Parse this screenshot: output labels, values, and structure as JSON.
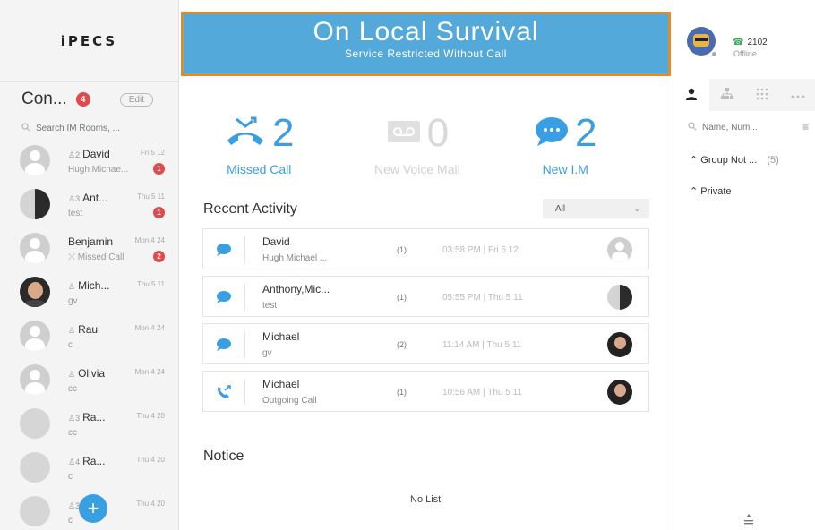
{
  "app": {
    "logo": "iPECS"
  },
  "banner": {
    "title": "On Local Survival",
    "subtitle": "Service Restricted Without Call"
  },
  "conversations": {
    "title": "Con...",
    "badge": "4",
    "edit_label": "Edit",
    "search_placeholder": "Search IM Rooms, ...",
    "items": [
      {
        "count": "2",
        "name": "David",
        "time": "Fri 5 12",
        "sub": "Hugh Michae...",
        "badge": "1",
        "avatar": "generic"
      },
      {
        "count": "3",
        "name": "Ant...",
        "time": "Thu 5 11",
        "sub": "test",
        "badge": "1",
        "avatar": "split"
      },
      {
        "count": "",
        "name": "Benjamin",
        "time": "Mon 4 24",
        "sub": "Missed Call",
        "badge": "2",
        "avatar": "generic"
      },
      {
        "count": "",
        "name": "Mich...",
        "time": "Thu 5 11",
        "sub": "gv",
        "badge": "",
        "avatar": "photo"
      },
      {
        "count": "",
        "name": "Raul",
        "time": "Mon 4 24",
        "sub": "c",
        "badge": "",
        "avatar": "generic"
      },
      {
        "count": "",
        "name": "Olivia",
        "time": "Mon 4 24",
        "sub": "cc",
        "badge": "",
        "avatar": "generic"
      },
      {
        "count": "3",
        "name": "Ra...",
        "time": "Thu 4 20",
        "sub": "cc",
        "badge": "",
        "avatar": "group"
      },
      {
        "count": "4",
        "name": "Ra...",
        "time": "Thu 4 20",
        "sub": "c",
        "badge": "",
        "avatar": "group"
      },
      {
        "count": "3",
        "name": "",
        "time": "Thu 4 20",
        "sub": "c",
        "badge": "",
        "avatar": "group"
      }
    ],
    "fab_label": "+"
  },
  "stats": [
    {
      "value": "2",
      "label": "Missed Call",
      "icon": "missed-call-icon"
    },
    {
      "value": "0",
      "label": "New Voice Mail",
      "icon": "voicemail-icon"
    },
    {
      "value": "2",
      "label": "New I.M",
      "icon": "chat-bubble-icon"
    }
  ],
  "recent": {
    "title": "Recent Activity",
    "filter": "All",
    "items": [
      {
        "name": "David",
        "sub": "Hugh Michael ...",
        "count": "(1)",
        "time": "03:58 PM | Fri 5 12",
        "icon": "chat-icon",
        "avatar": "generic"
      },
      {
        "name": "Anthony,Mic...",
        "sub": "test",
        "count": "(1)",
        "time": "05:55 PM | Thu 5 11",
        "icon": "chat-icon",
        "avatar": "split"
      },
      {
        "name": "Michael",
        "sub": "gv",
        "count": "(2)",
        "time": "11:14 AM | Thu 5 11",
        "icon": "chat-icon",
        "avatar": "photo"
      },
      {
        "name": "Michael",
        "sub": "Outgoing Call",
        "count": "(1)",
        "time": "10:56 AM | Thu 5 11",
        "icon": "outgoing-call-icon",
        "avatar": "photo"
      }
    ]
  },
  "notice": {
    "title": "Notice",
    "empty": "No List"
  },
  "profile": {
    "extension": "2102",
    "status": "Offline"
  },
  "contacts": {
    "search_placeholder": "Name, Num...",
    "groups": [
      {
        "label": "Group Not ...",
        "count": "(5)"
      },
      {
        "label": "Private",
        "count": ""
      }
    ]
  },
  "colors": {
    "accent": "#3a9ee3",
    "banner": "#53a9d9",
    "banner_border": "#e58a2a",
    "badge": "#e04a4a"
  }
}
